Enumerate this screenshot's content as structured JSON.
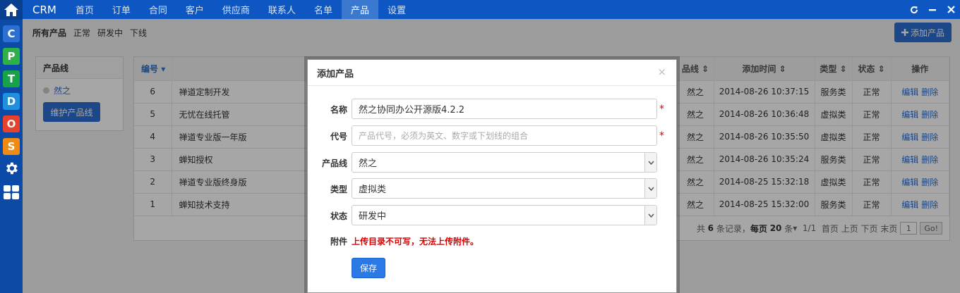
{
  "nav": {
    "brand": "CRM",
    "items": [
      "首页",
      "订单",
      "合同",
      "客户",
      "供应商",
      "联系人",
      "名单",
      "产品",
      "设置"
    ],
    "active_index": 7
  },
  "dock": {
    "apps": [
      {
        "letter": "C",
        "color": "#2b6fd3"
      },
      {
        "letter": "P",
        "color": "#2fb14a"
      },
      {
        "letter": "T",
        "color": "#17a34a"
      },
      {
        "letter": "D",
        "color": "#1f8fe0"
      },
      {
        "letter": "O",
        "color": "#e8412b"
      },
      {
        "letter": "S",
        "color": "#f08a12"
      }
    ]
  },
  "subbar": {
    "items": [
      "所有产品",
      "正常",
      "研发中",
      "下线"
    ],
    "add_button": "添加产品"
  },
  "sidebar": {
    "title": "产品线",
    "item": "然之",
    "button": "维护产品线"
  },
  "table": {
    "headers": [
      "编号",
      "",
      "品线",
      "添加时间",
      "类型",
      "状态",
      "操作"
    ],
    "rows": [
      {
        "id": "6",
        "name": "禅道定制开发",
        "line": "然之",
        "time": "2014-08-26 10:37:15",
        "type": "服务类",
        "status": "正常"
      },
      {
        "id": "5",
        "name": "无忧在线托管",
        "line": "然之",
        "time": "2014-08-26 10:36:48",
        "type": "虚拟类",
        "status": "正常"
      },
      {
        "id": "4",
        "name": "禅道专业版一年版",
        "line": "然之",
        "time": "2014-08-26 10:35:50",
        "type": "虚拟类",
        "status": "正常"
      },
      {
        "id": "3",
        "name": "蝉知授权",
        "line": "然之",
        "time": "2014-08-26 10:35:24",
        "type": "服务类",
        "status": "正常"
      },
      {
        "id": "2",
        "name": "禅道专业版终身版",
        "line": "然之",
        "time": "2014-08-25 15:32:18",
        "type": "虚拟类",
        "status": "正常"
      },
      {
        "id": "1",
        "name": "蝉知技术支持",
        "line": "然之",
        "time": "2014-08-25 15:32:00",
        "type": "服务类",
        "status": "正常"
      }
    ],
    "action_edit": "编辑",
    "action_delete": "删除",
    "pager": {
      "prefix": "共",
      "total": "6",
      "mid": "条记录，",
      "per_label": "每页",
      "per": "20",
      "per_unit": "条",
      "pages": "1/1",
      "nav": "首页 上页 下页 末页",
      "page_input": "1",
      "go": "Go!"
    }
  },
  "modal": {
    "title": "添加产品",
    "close": "×",
    "fields": {
      "name_label": "名称",
      "name_value": "然之协同办公开源版4.2.2",
      "code_label": "代号",
      "code_placeholder": "产品代号，必须为英文、数字或下划线的组合",
      "line_label": "产品线",
      "line_value": "然之",
      "type_label": "类型",
      "type_value": "虚拟类",
      "status_label": "状态",
      "status_value": "研发中",
      "attach_label": "附件",
      "attach_error": "上传目录不可写，无法上传附件。"
    },
    "required_mark": "*",
    "save": "保存"
  }
}
